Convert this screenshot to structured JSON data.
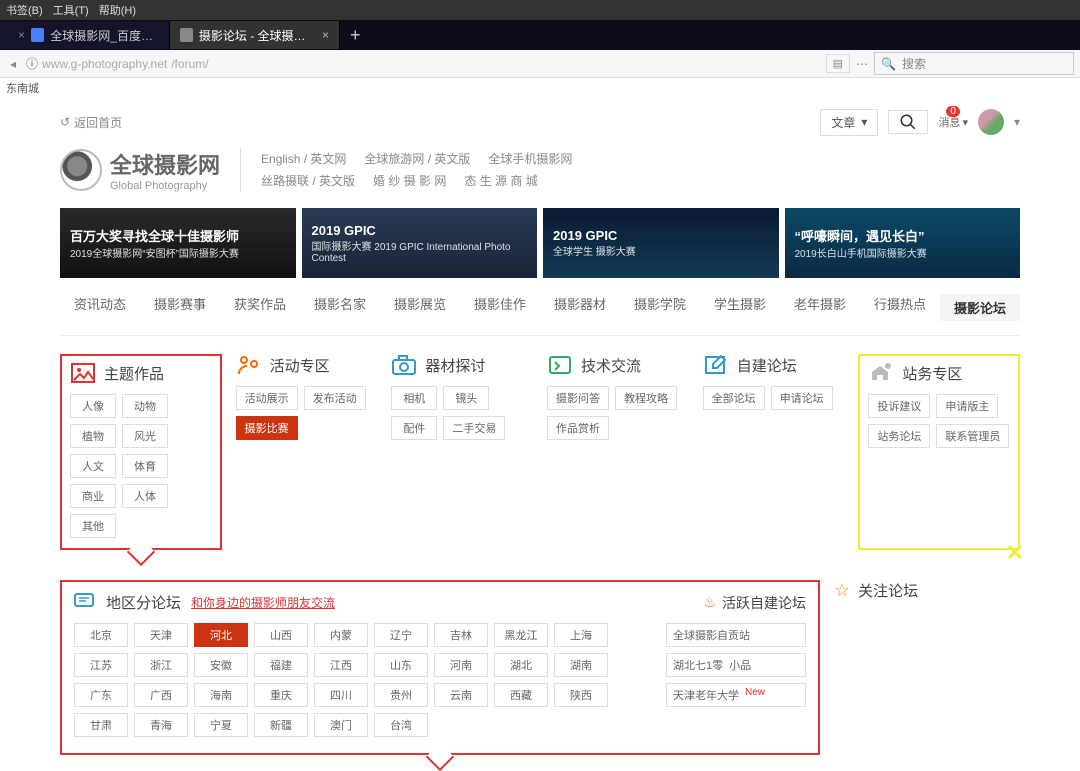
{
  "chrome": {
    "menu": [
      "书签(B)",
      "工具(T)",
      "帮助(H)"
    ],
    "tabs": [
      {
        "title": "全球摄影网_百度搜索",
        "active": false
      },
      {
        "title": "摄影论坛 - 全球摄影网",
        "active": true
      }
    ],
    "url_info": "ⓘ",
    "url_host": "www.g-photography.net",
    "url_path": "/forum/",
    "search_placeholder": "搜索",
    "bookmark_bar": "东南城"
  },
  "util": {
    "back": "返回首页",
    "dropdown": "文章",
    "msg": "消息",
    "badge": "0"
  },
  "logo": {
    "cn": "全球摄影网",
    "en": "Global Photography"
  },
  "header_links": {
    "row1": [
      "English / 英文网",
      "全球旅游网 / 英文版",
      "全球手机摄影网"
    ],
    "row2": [
      "丝路摄联 / 英文版",
      "婚 纱 摄 影 网",
      "态 生 源 商 城"
    ]
  },
  "banners": [
    {
      "t1": "百万大奖寻找全球十佳摄影师",
      "t2": "2019全球摄影网“安图杯”国际摄影大赛"
    },
    {
      "t1": "2019 GPIC",
      "t2": "国际摄影大赛  2019 GPIC International Photo Contest"
    },
    {
      "t1": "2019 GPIC",
      "t2": "全球学生 摄影大赛"
    },
    {
      "t1": "“呼嚎瞬间，遇见长白”",
      "t2": "2019长白山手机国际摄影大赛"
    }
  ],
  "mainnav": [
    "资讯动态",
    "摄影赛事",
    "获奖作品",
    "摄影名家",
    "摄影展览",
    "摄影佳作",
    "摄影器材",
    "摄影学院",
    "学生摄影",
    "老年摄影",
    "行摄热点",
    "摄影论坛"
  ],
  "cats": [
    {
      "title": "主题作品",
      "color": "#d33",
      "tags": [
        "人像",
        "动物",
        "植物",
        "风光",
        "人文",
        "体育",
        "商业",
        "人体",
        "其他"
      ]
    },
    {
      "title": "活动专区",
      "color": "#f60",
      "tags": [
        "活动展示",
        "发布活动"
      ],
      "active": "摄影比赛"
    },
    {
      "title": "器材探讨",
      "color": "#39c",
      "tags": [
        "相机",
        "镜头",
        "配件",
        "二手交易"
      ]
    },
    {
      "title": "技术交流",
      "color": "#3a6",
      "tags": [
        "摄影问答",
        "教程攻略",
        "作品赏析"
      ]
    },
    {
      "title": "自建论坛",
      "color": "#39c",
      "tags": [
        "全部论坛",
        "申请论坛"
      ]
    },
    {
      "title": "站务专区",
      "color": "#999",
      "tags": [
        "投诉建议",
        "申请版主",
        "站务论坛",
        "联系管理员"
      ]
    }
  ],
  "region": {
    "title": "地区分论坛",
    "sub": "和你身边的摄影师朋友交流",
    "hot": "活跃自建论坛",
    "provinces": [
      "北京",
      "天津",
      "河北",
      "山西",
      "内蒙",
      "辽宁",
      "吉林",
      "黑龙江",
      "上海",
      "江苏",
      "浙江",
      "安徽",
      "福建",
      "江西",
      "山东",
      "河南",
      "湖北",
      "湖南",
      "广东",
      "广西",
      "海南",
      "重庆",
      "四川",
      "贵州",
      "云南",
      "西藏",
      "陕西",
      "甘肃",
      "青海",
      "宁夏",
      "新疆",
      "澳门",
      "台湾"
    ],
    "active": "河北",
    "side": [
      {
        "label": "全球摄影自贡站"
      },
      {
        "label": "湖北七1零",
        "extra": "小品"
      },
      {
        "label": "天津老年大学",
        "new": "New"
      }
    ]
  },
  "follow": "关注论坛"
}
